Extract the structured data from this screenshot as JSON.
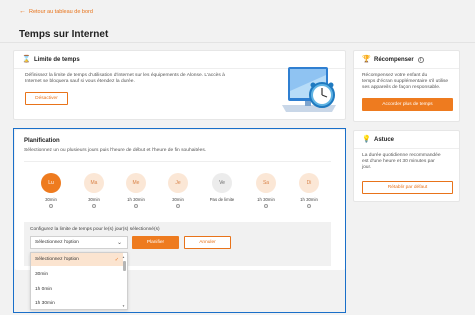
{
  "nav": {
    "back_label": "Retour au tableau de bord"
  },
  "page": {
    "title": "Temps sur Internet"
  },
  "limit_card": {
    "title": "Limite de temps",
    "description_1": "Définissez la limite de temps d'utilisation d'internet sur les équipements de Alonse. L'accès à",
    "description_2": "Internet se bloquera sauf si vous étendez la durée.",
    "button": "Désactiver"
  },
  "reward_card": {
    "title": "Récompenser",
    "line1": "Récompensez votre enfant du",
    "line2": "temps d'écran supplémentaire s'il utilise",
    "line3": "ses appareils de façon responsable.",
    "button": "Accorder plus de temps"
  },
  "tip_card": {
    "title": "Astuce",
    "line1": "La durée quotidienne recommandée",
    "line2": "est d'une heure et 30 minutes par",
    "line3": "jour.",
    "button": "Rétablir par défaut"
  },
  "planning": {
    "title": "Planification",
    "subtitle": "Sélectionnez un ou plusieurs jours puis l'heure de début et l'heure de fin souhaitées.",
    "days": [
      {
        "abbr": "Lu",
        "value": "30min",
        "state": "selected"
      },
      {
        "abbr": "Ma",
        "value": "30min",
        "state": "normal"
      },
      {
        "abbr": "Me",
        "value": "1h 30min",
        "state": "normal"
      },
      {
        "abbr": "Je",
        "value": "30min",
        "state": "normal"
      },
      {
        "abbr": "Ve",
        "value": "Pas de limite",
        "state": "grey"
      },
      {
        "abbr": "Sa",
        "value": "1h 30min",
        "state": "normal"
      },
      {
        "abbr": "Di",
        "value": "1h 30min",
        "state": "normal"
      }
    ],
    "config_label": "Configurez la limite de temps pour le(s) jour(s) sélectionné(s)",
    "select_value": "Sélectionnez l'option",
    "plan_button": "Planifier",
    "cancel_button": "Annuler",
    "options": [
      "Sélectionnez l'option",
      "30min",
      "1h 0min",
      "1h 30min"
    ]
  },
  "colors": {
    "accent": "#ee7b1f",
    "highlight_border": "#1a6fc9"
  }
}
